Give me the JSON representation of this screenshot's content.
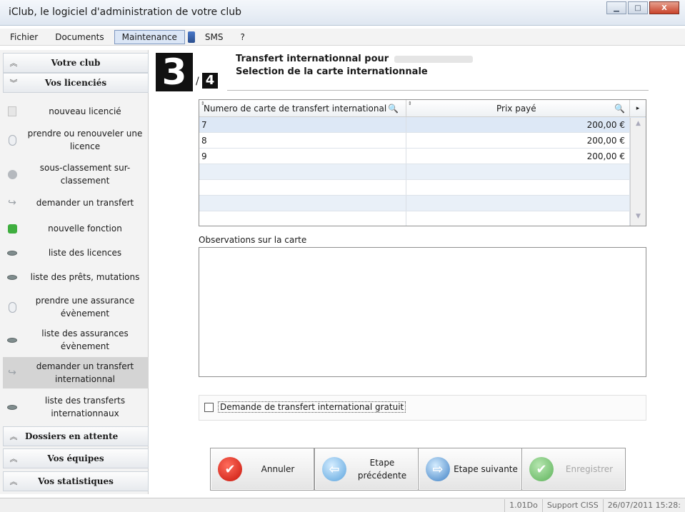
{
  "window": {
    "title": "iClub, le logiciel d'administration de votre club",
    "buttons": {
      "minimize": "▁",
      "maximize": "□",
      "close": "X"
    }
  },
  "menu": [
    "Fichier",
    "Documents",
    "Maintenance",
    "SMS",
    "?"
  ],
  "sidebar": {
    "sections": {
      "votre_club": "Votre club",
      "vos_licencies": "Vos licenciés",
      "dossiers": "Dossiers en attente",
      "equipes": "Vos équipes",
      "statistiques": "Vos statistiques"
    },
    "items": [
      {
        "label": "nouveau licencié",
        "icon": "document-icon"
      },
      {
        "label": "prendre ou renouveler une licence",
        "icon": "clip-icon"
      },
      {
        "label": "sous-classement sur-classement",
        "icon": "person-icon"
      },
      {
        "label": "demander un transfert",
        "icon": "arrow-icon"
      },
      {
        "label": "nouvelle fonction",
        "icon": "plus-icon"
      },
      {
        "label": "liste des licences",
        "icon": "eye-icon"
      },
      {
        "label": "liste des prêts, mutations",
        "icon": "eye-icon"
      },
      {
        "label": "prendre une assurance évènement",
        "icon": "clip-icon"
      },
      {
        "label": "liste des assurances évènement",
        "icon": "eye-icon"
      },
      {
        "label": "demander un transfert internationnal",
        "icon": "arrow-icon",
        "selected": true
      },
      {
        "label": "liste des transferts internationnaux",
        "icon": "eye-icon"
      }
    ]
  },
  "wizard": {
    "current_step": "3",
    "separator": "/",
    "total_steps": "4",
    "title_line1": "Transfert internationnal pour",
    "title_line2": "Selection de la carte internationnale"
  },
  "grid": {
    "columns": [
      "Numero de carte de transfert international",
      "Prix payé"
    ],
    "rows": [
      {
        "numero": "7",
        "prix": "200,00 €"
      },
      {
        "numero": "8",
        "prix": "200,00 €"
      },
      {
        "numero": "9",
        "prix": "200,00 €"
      },
      {
        "numero": "",
        "prix": ""
      },
      {
        "numero": "",
        "prix": ""
      },
      {
        "numero": "",
        "prix": ""
      },
      {
        "numero": "",
        "prix": ""
      }
    ]
  },
  "observations": {
    "label": "Observations sur la carte",
    "value": ""
  },
  "checkbox": {
    "label": "Demande de transfert international gratuit",
    "checked": false
  },
  "buttons": {
    "annuler": "Annuler",
    "precedent": "Etape précédente",
    "suivant": "Etape suivante",
    "enregistrer": "Enregistrer"
  },
  "status": {
    "version": "1.01Do",
    "support": "Support CISS",
    "datetime": "26/07/2011 15:28:"
  },
  "colors": {
    "selected_row": "#dde8f6",
    "cancel_icon": "#c8160c",
    "nav_icon": "#3d7fc4"
  }
}
